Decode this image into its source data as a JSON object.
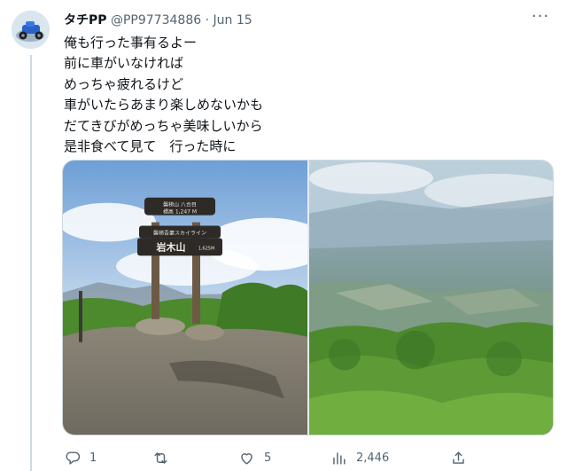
{
  "tweet": {
    "display_name": "タチPP",
    "handle": "@PP97734886",
    "separator": "·",
    "date": "Jun 15",
    "more_label": "···",
    "lines": [
      "俺も行った事有るよー",
      "前に車がいなければ",
      "めっちゃ疲れるけど",
      "車がいたらあまり楽しめないかも",
      "だてきびがめっちゃ美味しいから",
      "是非食べて見て　行った時に"
    ],
    "sign": {
      "top_line": "磐梯山 八合目",
      "elevation": "標高 1,247 M",
      "road": "磐梯吾妻スカイライン",
      "peak": "岩木山",
      "peak_elevation": "1,625M"
    },
    "actions": {
      "replies": "1",
      "retweets": "",
      "likes": "5",
      "views": "2,446"
    }
  },
  "colors": {
    "text_primary": "#0f1419",
    "text_secondary": "#536471",
    "thread_line": "#cfd9de",
    "sky": "#8db8e3",
    "foliage": "#4d8a2e"
  },
  "icons": [
    "avatar-image",
    "more-icon",
    "reply-icon",
    "retweet-icon",
    "like-icon",
    "views-icon",
    "share-icon"
  ]
}
